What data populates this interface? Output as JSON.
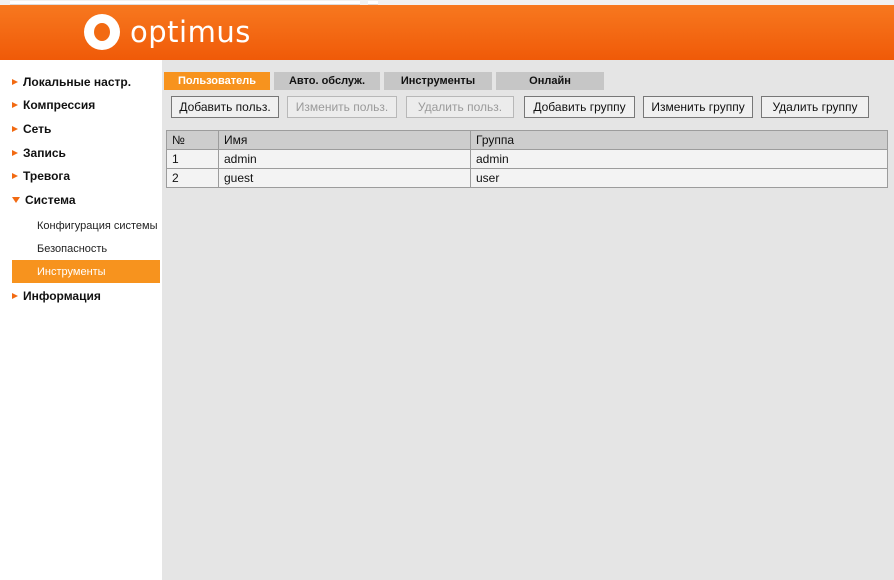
{
  "brand": {
    "name": "optimus",
    "accent": "#f26a12"
  },
  "sidebar": {
    "items": [
      {
        "label": "Локальные настр.",
        "icon": "triangle-right-icon"
      },
      {
        "label": "Компрессия",
        "icon": "triangle-right-icon"
      },
      {
        "label": "Сеть",
        "icon": "triangle-right-icon"
      },
      {
        "label": "Запись",
        "icon": "triangle-right-icon"
      },
      {
        "label": "Тревога",
        "icon": "triangle-right-icon"
      },
      {
        "label": "Система",
        "icon": "triangle-down-icon",
        "expanded": true
      },
      {
        "label": "Информация",
        "icon": "triangle-right-icon"
      }
    ],
    "system_subitems": [
      {
        "label": "Конфигурация системы"
      },
      {
        "label": "Безопасность"
      },
      {
        "label": "Инструменты",
        "active": true
      }
    ]
  },
  "tabs": [
    {
      "label": "Пользователь",
      "active": true
    },
    {
      "label": "Авто. обслуж."
    },
    {
      "label": "Инструменты"
    },
    {
      "label": "Онлайн"
    }
  ],
  "buttons": [
    {
      "label": "Добавить польз.",
      "enabled": true
    },
    {
      "label": "Изменить польз.",
      "enabled": false
    },
    {
      "label": "Удалить польз.",
      "enabled": false
    },
    {
      "label": "Добавить группу",
      "enabled": true
    },
    {
      "label": "Изменить группу",
      "enabled": true
    },
    {
      "label": "Удалить группу",
      "enabled": true
    }
  ],
  "table": {
    "headers": [
      "№",
      "Имя",
      "Группа"
    ],
    "rows": [
      [
        "1",
        "admin",
        "admin"
      ],
      [
        "2",
        "guest",
        "user"
      ]
    ]
  }
}
